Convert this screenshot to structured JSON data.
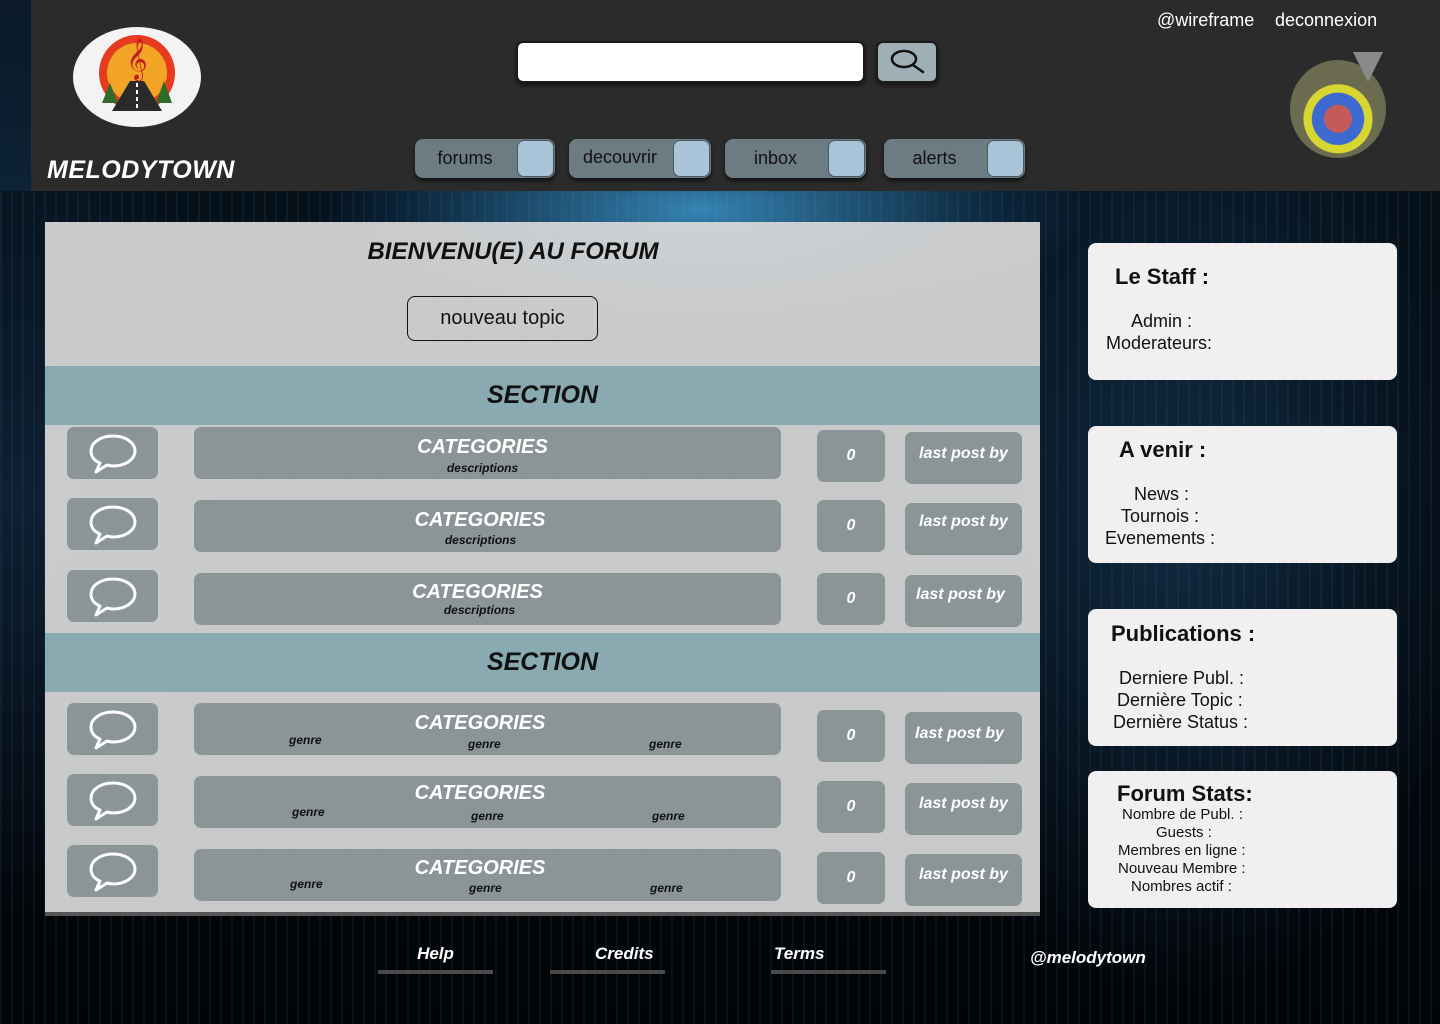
{
  "header": {
    "brand": "MELODYTOWN",
    "username": "@wireframe",
    "logout_label": "deconnexion",
    "search": {
      "value": "",
      "placeholder": ""
    },
    "nav": [
      {
        "label": "forums"
      },
      {
        "label": "decouvrir"
      },
      {
        "label": "inbox"
      },
      {
        "label": "alerts"
      }
    ]
  },
  "main": {
    "welcome_title": "BIENVENU(E) AU FORUM",
    "new_topic_label": "nouveau topic",
    "sections": [
      {
        "title": "SECTION",
        "rows": [
          {
            "category": "CATEGORIES",
            "description": "descriptions",
            "count": "0",
            "last_post": "last post by"
          },
          {
            "category": "CATEGORIES",
            "description": "descriptions",
            "count": "0",
            "last_post": "last post by"
          },
          {
            "category": "CATEGORIES",
            "description": "descriptions",
            "count": "0",
            "last_post": "last post by"
          }
        ]
      },
      {
        "title": "SECTION",
        "rows": [
          {
            "category": "CATEGORIES",
            "genres": [
              "genre",
              "genre",
              "genre"
            ],
            "count": "0",
            "last_post": "last post by"
          },
          {
            "category": "CATEGORIES",
            "genres": [
              "genre",
              "genre",
              "genre"
            ],
            "count": "0",
            "last_post": "last post by"
          },
          {
            "category": "CATEGORIES",
            "genres": [
              "genre",
              "genre",
              "genre"
            ],
            "count": "0",
            "last_post": "last post by"
          }
        ]
      }
    ]
  },
  "sidebar": {
    "staff": {
      "title": "Le Staff :",
      "lines": [
        "Admin :",
        "Moderateurs:"
      ]
    },
    "upcoming": {
      "title": "A venir :",
      "lines": [
        "News :",
        "Tournois :",
        "Evenements :"
      ]
    },
    "publications": {
      "title": "Publications :",
      "lines": [
        "Derniere Publ. :",
        "Dernière Topic :",
        "Dernière Status :"
      ]
    },
    "stats": {
      "title": "Forum Stats:",
      "lines": [
        "Nombre de Publ. :",
        "Guests :",
        "Membres en ligne :",
        "Nouveau Membre :",
        "Nombres actif :"
      ]
    }
  },
  "footer": {
    "links": [
      {
        "label": "Help"
      },
      {
        "label": "Credits"
      },
      {
        "label": "Terms"
      }
    ],
    "handle": "@melodytown"
  },
  "colors": {
    "header_bg": "#2b2b2b",
    "section_bar": "#88aab0",
    "row_tile": "#8b9597",
    "nav_tab": "#6d7b83",
    "nav_tab_square": "#a9c4d8",
    "card_bg": "#f1efef"
  },
  "icons": {
    "search": "magnifier-icon",
    "row": "speech-bubble-icon",
    "logo": "music-road-logo"
  }
}
